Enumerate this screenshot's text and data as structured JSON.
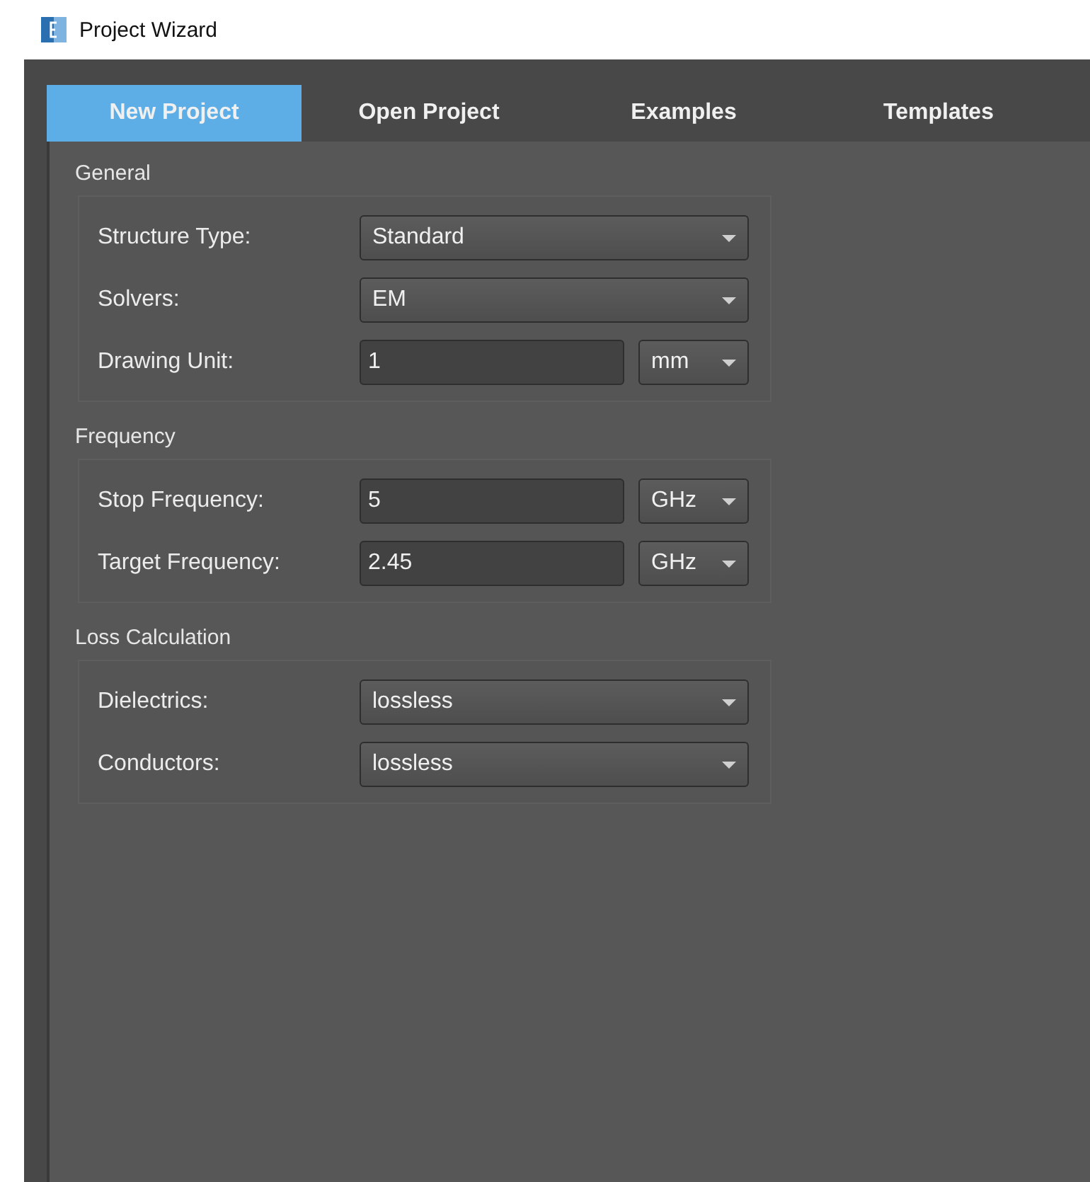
{
  "window": {
    "title": "Project Wizard"
  },
  "tabs": [
    {
      "label": "New Project",
      "selected": true
    },
    {
      "label": "Open Project",
      "selected": false
    },
    {
      "label": "Examples",
      "selected": false
    },
    {
      "label": "Templates",
      "selected": false
    }
  ],
  "groups": [
    {
      "title": "General",
      "rows": [
        {
          "kind": "combo",
          "label": "Structure Type:",
          "value": "Standard"
        },
        {
          "kind": "combo",
          "label": "Solvers:",
          "value": "EM"
        },
        {
          "kind": "input_unit",
          "label": "Drawing Unit:",
          "value": "1",
          "unit": "mm"
        }
      ]
    },
    {
      "title": "Frequency",
      "rows": [
        {
          "kind": "input_unit",
          "label": "Stop Frequency:",
          "value": "5",
          "unit": "GHz"
        },
        {
          "kind": "input_unit",
          "label": "Target Frequency:",
          "value": "2.45",
          "unit": "GHz"
        }
      ]
    },
    {
      "title": "Loss Calculation",
      "rows": [
        {
          "kind": "combo",
          "label": "Dielectrics:",
          "value": "lossless"
        },
        {
          "kind": "combo",
          "label": "Conductors:",
          "value": "lossless"
        }
      ]
    }
  ]
}
